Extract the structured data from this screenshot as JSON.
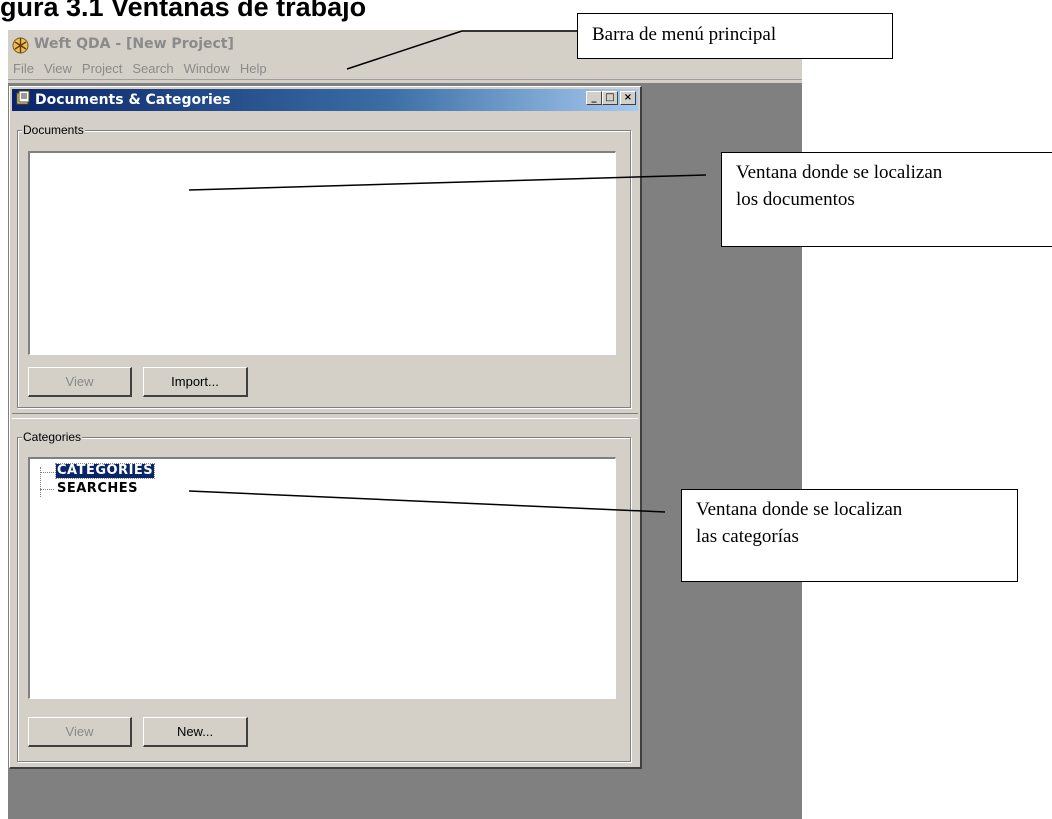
{
  "figure": {
    "title": "gura 3.1 Ventanas de trabajo"
  },
  "app": {
    "title": "Weft QDA - [New Project]",
    "icon": "weft-qda-icon",
    "menu": [
      "File",
      "View",
      "Project",
      "Search",
      "Window",
      "Help"
    ]
  },
  "child_window": {
    "title": "Documents & Categories",
    "icon": "documents-categories-icon",
    "buttons": {
      "minimize": "_",
      "maximize": "□",
      "close": "×"
    }
  },
  "documents": {
    "group_label": "Documents",
    "view_button": "View",
    "import_button": "Import..."
  },
  "categories": {
    "group_label": "Categories",
    "tree": [
      "CATEGORIES",
      "SEARCHES"
    ],
    "view_button": "View",
    "new_button": "New..."
  },
  "annotations": {
    "menu": "Barra de menú principal",
    "documents_line1": "Ventana donde se localizan",
    "documents_line2": "los documentos",
    "categories_line1": "Ventana donde se localizan",
    "categories_line2": "las categorías"
  },
  "colors": {
    "window_face": "#d4d0c8",
    "mdi_background": "#808080",
    "titlebar_active_start": "#0a246a",
    "titlebar_active_end": "#a6caf0",
    "selection": "#0a246a",
    "disabled_text": "#8a8a8a"
  }
}
